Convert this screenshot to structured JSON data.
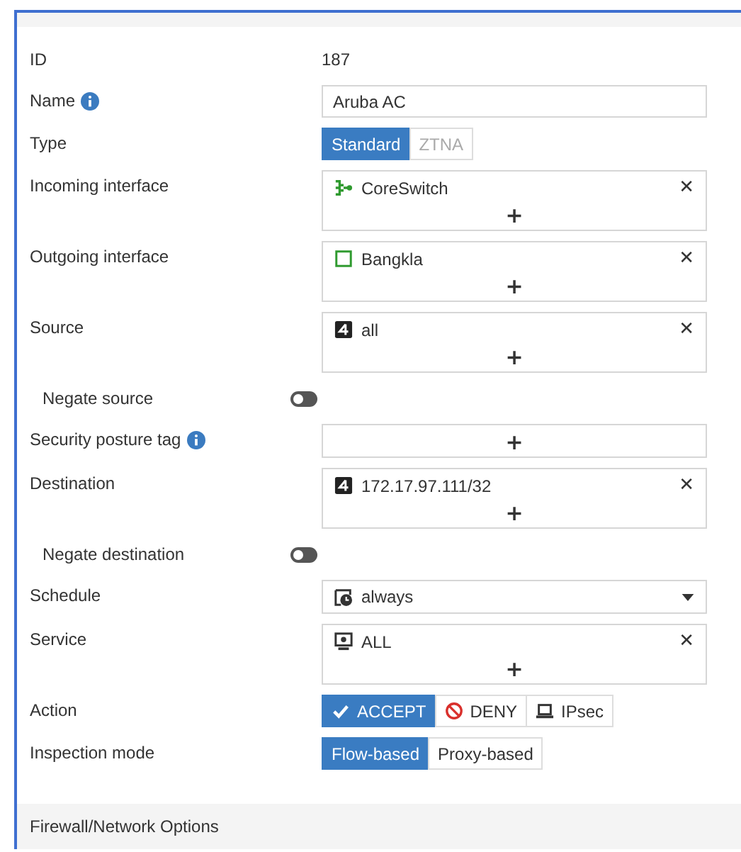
{
  "fields": [
    {
      "kind": "text",
      "label": "ID",
      "value": "187"
    },
    {
      "kind": "input",
      "label": "Name",
      "info": true,
      "value": "Aruba AC"
    },
    {
      "kind": "segmented",
      "label": "Type",
      "options": [
        {
          "label": "Standard",
          "selected": true,
          "disabled": false
        },
        {
          "label": "ZTNA",
          "selected": false,
          "disabled": true
        }
      ]
    },
    {
      "kind": "multiselect",
      "label": "Incoming interface",
      "add": "+",
      "items": [
        {
          "kind": "interface",
          "label": "CoreSwitch",
          "remove": "✕"
        }
      ]
    },
    {
      "kind": "multiselect",
      "label": "Outgoing interface",
      "add": "+",
      "items": [
        {
          "kind": "port",
          "label": "Bangkla",
          "remove": "✕"
        }
      ]
    },
    {
      "kind": "multiselect",
      "label": "Source",
      "add": "+",
      "items": [
        {
          "kind": "address",
          "label": "all",
          "remove": "✕"
        }
      ]
    },
    {
      "kind": "toggle",
      "label": "Negate source",
      "on": false
    },
    {
      "kind": "multiselect",
      "label": "Security posture tag",
      "info": true,
      "add": "+"
    },
    {
      "kind": "multiselect",
      "label": "Destination",
      "add": "+",
      "items": [
        {
          "kind": "address",
          "label": "172.17.97.111/32",
          "remove": "✕"
        }
      ]
    },
    {
      "kind": "toggle",
      "label": "Negate destination",
      "on": false
    },
    {
      "kind": "select",
      "label": "Schedule",
      "item": {
        "kind": "schedule",
        "label": "always"
      }
    },
    {
      "kind": "multiselect",
      "label": "Service",
      "add": "+",
      "items": [
        {
          "kind": "service",
          "label": "ALL",
          "remove": "✕"
        }
      ]
    },
    {
      "kind": "segmented",
      "label": "Action",
      "options": [
        {
          "label": "ACCEPT",
          "kind": "accept",
          "selected": true,
          "disabled": false
        },
        {
          "label": "DENY",
          "kind": "deny",
          "selected": false,
          "disabled": false
        },
        {
          "label": "IPsec",
          "kind": "ipsec",
          "selected": false,
          "disabled": false
        }
      ]
    },
    {
      "kind": "segmented",
      "label": "Inspection mode",
      "options": [
        {
          "label": "Flow-based",
          "selected": true,
          "disabled": false
        },
        {
          "label": "Proxy-based",
          "selected": false,
          "disabled": false
        }
      ]
    }
  ],
  "section": {
    "title": "Firewall/Network Options"
  }
}
